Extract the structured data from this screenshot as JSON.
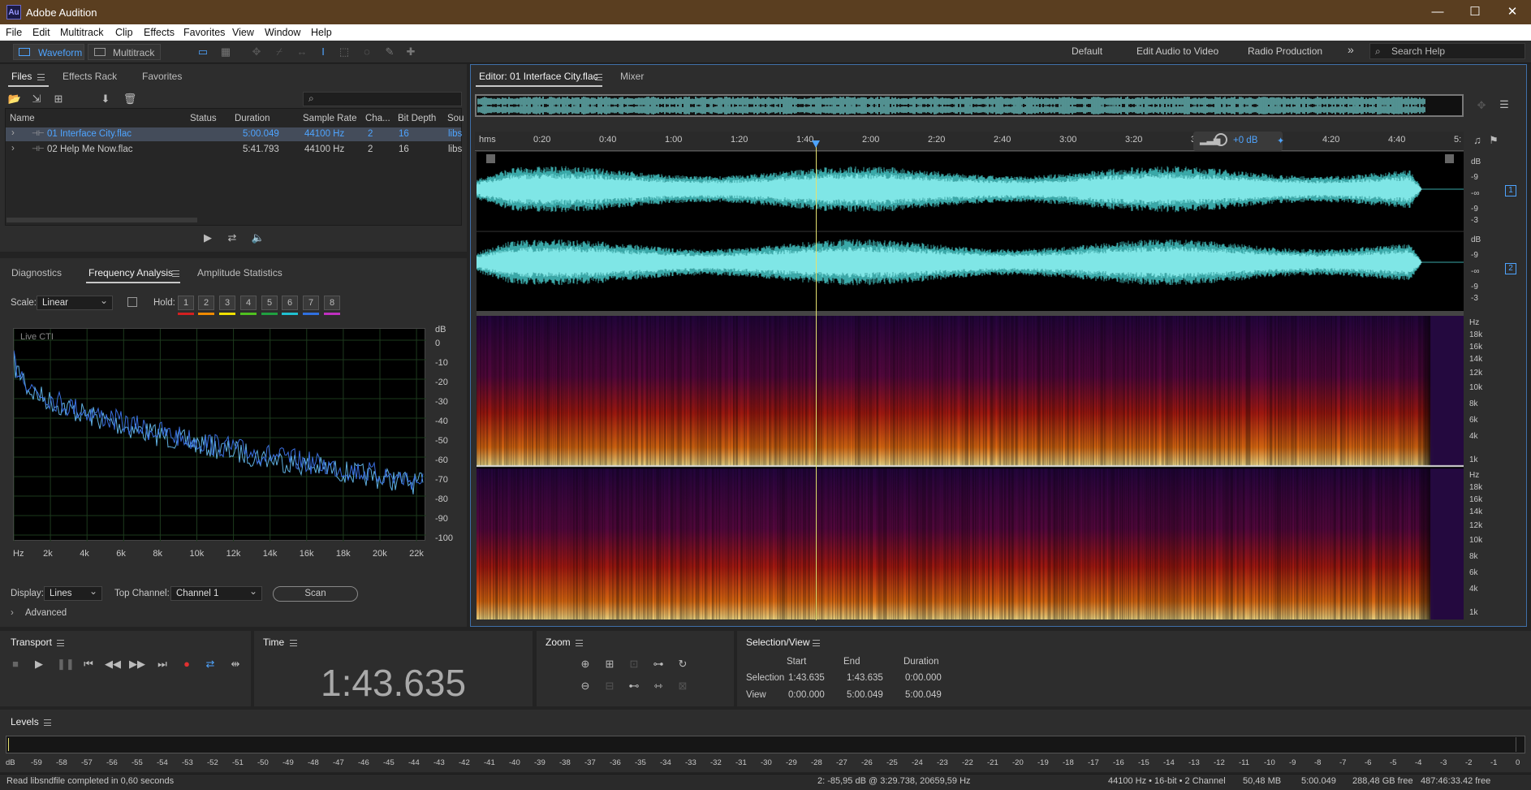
{
  "app": {
    "logo": "Au",
    "title": "Adobe Audition"
  },
  "window_controls": [
    "—",
    "☐",
    "✕"
  ],
  "menu": [
    "File",
    "Edit",
    "Multitrack",
    "Clip",
    "Effects",
    "Favorites",
    "View",
    "Window",
    "Help"
  ],
  "toolbar": {
    "waveform": "Waveform",
    "multitrack": "Multitrack",
    "workspaces": [
      "Default",
      "Edit Audio to Video",
      "Radio Production"
    ],
    "more": "»",
    "search_help": "Search Help"
  },
  "files_panel": {
    "tabs": [
      "Files",
      "Effects Rack",
      "Favorites"
    ],
    "columns": [
      "Name",
      "Status",
      "Duration",
      "Sample Rate",
      "Cha...",
      "Bit Depth",
      "Sou"
    ],
    "rows": [
      {
        "name": "01 Interface City.flac",
        "status": "",
        "duration": "5:00.049",
        "rate": "44100 Hz",
        "ch": "2",
        "bit": "16",
        "src": "libs"
      },
      {
        "name": "02 Help Me Now.flac",
        "status": "",
        "duration": "5:41.793",
        "rate": "44100 Hz",
        "ch": "2",
        "bit": "16",
        "src": "libs"
      }
    ]
  },
  "analysis_panel": {
    "tabs": [
      "Diagnostics",
      "Frequency Analysis",
      "Amplitude Statistics"
    ],
    "scale_label": "Scale:",
    "scale_value": "Linear",
    "hold_label": "Hold:",
    "hold": [
      "1",
      "2",
      "3",
      "4",
      "5",
      "6",
      "7",
      "8"
    ],
    "hold_colors": [
      "#d42020",
      "#f08a00",
      "#f0e000",
      "#50c020",
      "#20a040",
      "#20c0d0",
      "#3070e0",
      "#c030c0"
    ],
    "live_cti": "Live CTI",
    "db_unit": "dB",
    "db_ticks": [
      "0",
      "-10",
      "-20",
      "-30",
      "-40",
      "-50",
      "-60",
      "-70",
      "-80",
      "-90",
      "-100"
    ],
    "hz_ticks": [
      "Hz",
      "2k",
      "4k",
      "6k",
      "8k",
      "10k",
      "12k",
      "14k",
      "16k",
      "18k",
      "20k",
      "22k"
    ],
    "display_label": "Display:",
    "display_value": "Lines",
    "top_channel_label": "Top Channel:",
    "top_channel_value": "Channel 1",
    "scan": "Scan",
    "advanced": "Advanced"
  },
  "editor": {
    "tabs": [
      "Editor: 01 Interface City.flac",
      "Mixer"
    ],
    "ruler": [
      "hms",
      "0:20",
      "0:40",
      "1:00",
      "1:20",
      "1:40",
      "2:00",
      "2:20",
      "2:40",
      "3:00",
      "3:20",
      "3:40",
      "4:00",
      "4:20",
      "4:40",
      "5:"
    ],
    "gain": "+0 dB",
    "wave_db": [
      "dB",
      "-9",
      "-∞",
      "-9",
      "-3"
    ],
    "channels": [
      "1",
      "2"
    ],
    "spec_hz": [
      "Hz",
      "18k",
      "16k",
      "14k",
      "12k",
      "10k",
      "8k",
      "6k",
      "4k",
      "1k"
    ]
  },
  "transport": {
    "title": "Transport"
  },
  "time": {
    "title": "Time",
    "value": "1:43.635"
  },
  "zoom": {
    "title": "Zoom"
  },
  "selection_view": {
    "title": "Selection/View",
    "headers": [
      "Start",
      "End",
      "Duration"
    ],
    "selection": {
      "label": "Selection",
      "start": "1:43.635",
      "end": "1:43.635",
      "duration": "0:00.000"
    },
    "view": {
      "label": "View",
      "start": "0:00.000",
      "end": "5:00.049",
      "duration": "5:00.049"
    }
  },
  "levels": {
    "title": "Levels",
    "ticks": [
      "dB",
      "-59",
      "-58",
      "-57",
      "-56",
      "-55",
      "-54",
      "-53",
      "-52",
      "-51",
      "-50",
      "-49",
      "-48",
      "-47",
      "-46",
      "-45",
      "-44",
      "-43",
      "-42",
      "-41",
      "-40",
      "-39",
      "-38",
      "-37",
      "-36",
      "-35",
      "-34",
      "-33",
      "-32",
      "-31",
      "-30",
      "-29",
      "-28",
      "-27",
      "-26",
      "-25",
      "-24",
      "-23",
      "-22",
      "-21",
      "-20",
      "-19",
      "-18",
      "-17",
      "-16",
      "-15",
      "-14",
      "-13",
      "-12",
      "-11",
      "-10",
      "-9",
      "-8",
      "-7",
      "-6",
      "-5",
      "-4",
      "-3",
      "-2",
      "-1",
      "0"
    ]
  },
  "status": {
    "left": "Read libsndfile completed in 0,60 seconds",
    "cursor": "2: -85,95 dB @ 3:29.738, 20659,59 Hz",
    "format": "44100 Hz • 16-bit • 2 Channel",
    "size": "50,48 MB",
    "duration": "5:00.049",
    "free": "288,48 GB free",
    "free_time": "487:46:33.42 free"
  }
}
